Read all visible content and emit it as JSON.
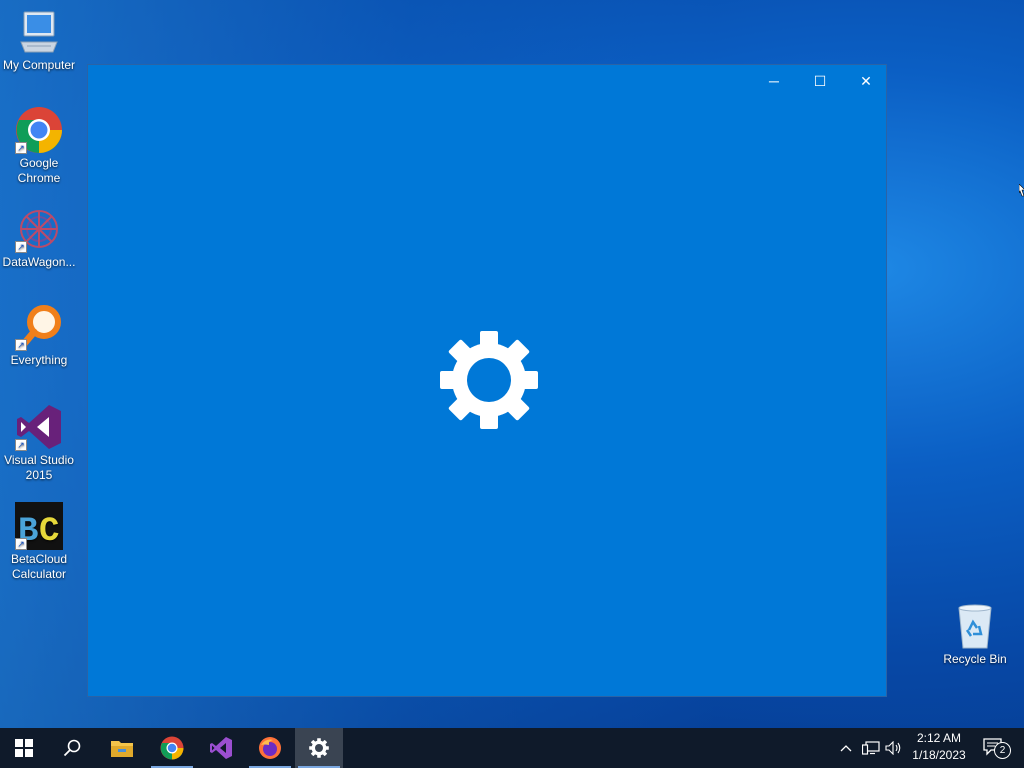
{
  "desktop": {
    "icons": [
      {
        "label": "My Computer"
      },
      {
        "label": "Google Chrome"
      },
      {
        "label": "DataWagon..."
      },
      {
        "label": "Everything"
      },
      {
        "label": "Visual Studio 2015"
      },
      {
        "label": "BetaCloud Calculator"
      },
      {
        "label": "Recycle Bin"
      }
    ]
  },
  "window": {
    "title": "",
    "minimize_glyph": "─",
    "maximize_glyph": "☐",
    "close_glyph": "✕",
    "splash_icon": "gear-icon",
    "background_color": "#0078d7"
  },
  "taskbar": {
    "items": [
      "start-icon",
      "search-icon",
      "file-explorer-icon",
      "chrome-icon",
      "visual-studio-icon",
      "firefox-icon",
      "settings-icon"
    ],
    "active": "settings-icon"
  },
  "tray": {
    "chevron": "^",
    "time": "2:12 AM",
    "date": "1/18/2023",
    "notification_count": "2"
  },
  "colors": {
    "accent": "#0078d7",
    "taskbar": "#0f1a2a"
  }
}
